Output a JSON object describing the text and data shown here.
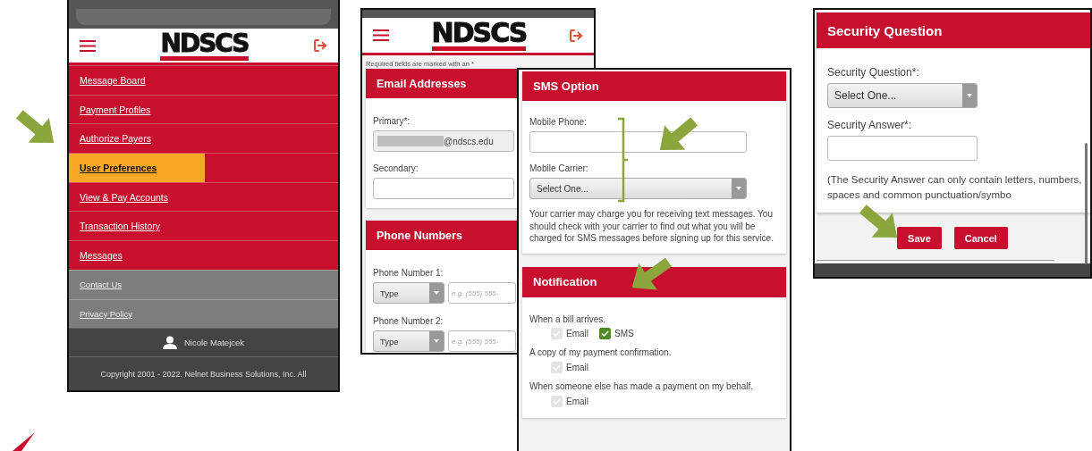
{
  "menu_screen": {
    "logo": "NDSCS",
    "menu_items": [
      {
        "label": "Message Board",
        "selected": false
      },
      {
        "label": "Payment Profiles",
        "selected": false
      },
      {
        "label": "Authorize Payers",
        "selected": false
      },
      {
        "label": "User Preferences",
        "selected": true
      },
      {
        "label": "View & Pay Accounts",
        "selected": false
      },
      {
        "label": "Transaction History",
        "selected": false
      },
      {
        "label": "Messages",
        "selected": false
      }
    ],
    "footer_links": [
      "Contact Us",
      "Privacy Policy"
    ],
    "user_name": "Nicole Matejcek",
    "copyright": "Copyright 2001 - 2022. Nelnet Business Solutions, Inc. All"
  },
  "contact_screen": {
    "logo": "NDSCS",
    "required_note": "Required fields are marked with an *",
    "email_section": {
      "title": "Email Addresses",
      "primary_label": "Primary*:",
      "primary_value": "@ndscs.edu",
      "secondary_label": "Secondary:"
    },
    "phone_section": {
      "title": "Phone Numbers",
      "phones": [
        {
          "label": "Phone Number 1:",
          "type": "Type",
          "placeholder": "e.g. (555) 555-"
        },
        {
          "label": "Phone Number 2:",
          "type": "Type",
          "placeholder": "e.g. (555) 555-"
        }
      ]
    }
  },
  "sms_screen": {
    "sms_section": {
      "title": "SMS Option",
      "phone_label": "Mobile Phone:",
      "carrier_label": "Mobile Carrier:",
      "carrier_value": "Select One...",
      "note": "Your carrier may charge you for receiving text messages. You should check with your carrier to find out what you will be charged for SMS messages before signing up for this service."
    },
    "notification_section": {
      "title": "Notification",
      "groups": [
        {
          "label": "When a bill arrives.",
          "options": [
            {
              "label": "Email",
              "checked": true,
              "disabled": true
            },
            {
              "label": "SMS",
              "checked": true,
              "disabled": false
            }
          ]
        },
        {
          "label": "A copy of my payment confirmation.",
          "options": [
            {
              "label": "Email",
              "checked": true,
              "disabled": true
            }
          ]
        },
        {
          "label": "When someone else has made a payment on my behalf.",
          "options": [
            {
              "label": "Email",
              "checked": true,
              "disabled": true
            }
          ]
        }
      ]
    }
  },
  "security_screen": {
    "title": "Security Question",
    "question_label": "Security Question*:",
    "question_value": "Select One...",
    "answer_label": "Security Answer*:",
    "note": "(The Security Answer can only contain letters, numbers, spaces and common punctuation/symbo",
    "buttons": [
      "Save",
      "Cancel"
    ]
  }
}
